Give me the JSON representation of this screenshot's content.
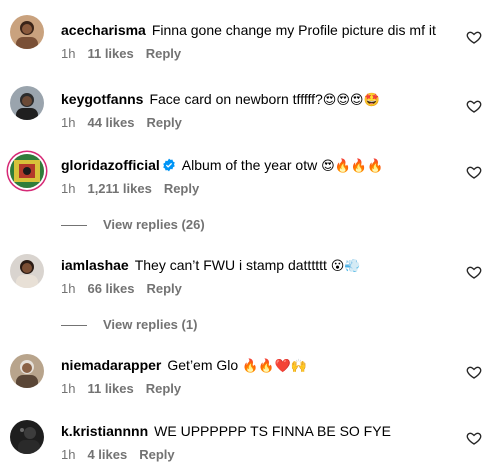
{
  "comments": [
    {
      "username": "acecharisma",
      "text": "Finna gone change my Profile picture dis mf it",
      "emoji": "",
      "time": "1h",
      "likes": "11 likes",
      "reply": "Reply",
      "verified": false
    },
    {
      "username": "keygotfanns",
      "text": "Face card on newborn tfffff?",
      "emoji": "😍😍😍🤩",
      "time": "1h",
      "likes": "44 likes",
      "reply": "Reply",
      "verified": false
    },
    {
      "username": "gloridazofficial",
      "text": "Album of the year otw",
      "emoji": "😍🔥🔥🔥",
      "time": "1h",
      "likes": "1,211 likes",
      "reply": "Reply",
      "verified": true
    },
    {
      "username": "iamlashae",
      "text": "They can’t FWU i stamp datttttt",
      "emoji": "😮💨",
      "time": "1h",
      "likes": "66 likes",
      "reply": "Reply",
      "verified": false
    },
    {
      "username": "niemadarapper",
      "text": "Get’em Glo",
      "emoji": "🔥🔥❤️🙌",
      "time": "1h",
      "likes": "11 likes",
      "reply": "Reply",
      "verified": false
    },
    {
      "username": "k.kristiannnn",
      "text": "WE UPPPPPP TS FINNA BE SO FYE",
      "emoji": "",
      "time": "1h",
      "likes": "4 likes",
      "reply": "Reply",
      "verified": false
    }
  ],
  "view_replies": [
    "View replies (26)",
    "View replies (1)"
  ],
  "colors": {
    "meta_text": "#737373",
    "story_ring": "#d62976",
    "verified_badge": "#0095f6"
  },
  "icons": {
    "like": "heart-outline-icon",
    "verified": "verified-badge-icon"
  }
}
